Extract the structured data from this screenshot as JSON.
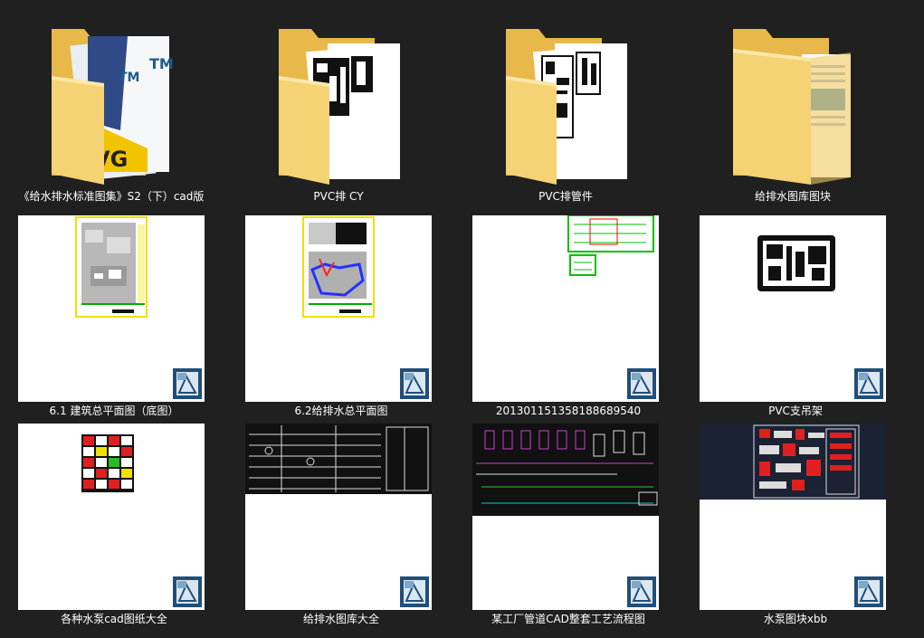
{
  "folders": [
    {
      "label": "《给水排水标准图集》S2（下）cad版",
      "thumb": "folder-cover-icon",
      "cover_text": [
        "TM",
        "TM",
        "VG"
      ]
    },
    {
      "label": "PVC排 CY",
      "thumb": "folder-cad-icon"
    },
    {
      "label": "PVC排管件",
      "thumb": "folder-cad-icon"
    },
    {
      "label": "给排水图库图块",
      "thumb": "folder-doc-icon"
    }
  ],
  "files": [
    {
      "label": "6.1 建筑总平面图（底图）",
      "thumb": "site-plan-drawing"
    },
    {
      "label": "6.2给排水总平面图",
      "thumb": "drainage-plan-drawing"
    },
    {
      "label": "20130115135818868954​0",
      "thumb": "green-plan-drawing"
    },
    {
      "label": "PVC支吊架",
      "thumb": "bracket-drawing"
    },
    {
      "label": "各种水泵cad图纸大全",
      "thumb": "pump-sheets-drawing"
    },
    {
      "label": "给排水图库大全",
      "thumb": "library-drawing"
    },
    {
      "label": "某工厂管道CAD整套工艺流程图",
      "thumb": "process-flow-drawing"
    },
    {
      "label": "水泵图块xbb",
      "thumb": "pump-blocks-drawing"
    }
  ],
  "colors": {
    "background": "#202020",
    "folder": "#f5d274",
    "folder_dark": "#e8b94a",
    "badge": "#1f4f7a"
  }
}
